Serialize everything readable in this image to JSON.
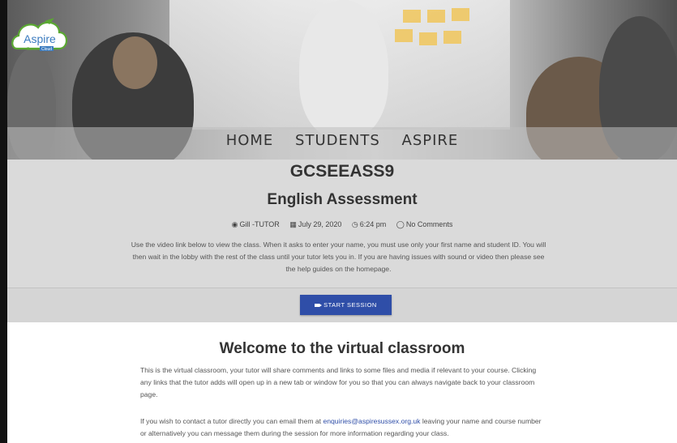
{
  "logo": {
    "name": "Aspire",
    "sub_left": "Sussex",
    "sub_right": "Cloud"
  },
  "nav": {
    "items": [
      "HOME",
      "STUDENTS",
      "ASPIRE"
    ]
  },
  "course": {
    "code": "GCSEEASS9",
    "title": "English Assessment"
  },
  "meta": {
    "author": "Gill -TUTOR",
    "date": "July 29, 2020",
    "time": "6:24 pm",
    "comments": "No Comments"
  },
  "intro": "Use the video link below to view the class. When it asks to enter your name, you must use only your first name and student ID. You will then wait in the lobby with the rest of the class until your tutor lets you in. If you are having issues with sound or video then please see the help guides on the homepage.",
  "start_button": {
    "label": "START SESSION"
  },
  "welcome": {
    "heading": "Welcome to the virtual classroom",
    "para1": "This is the virtual classroom, your tutor will share comments and links to some files and media if relevant to your course. Clicking any links that the tutor adds will open up in a new tab or window for you so that you can always navigate back to your classroom page.",
    "para2_before": "If you wish to contact a tutor directly you can email them at ",
    "para2_email": "enquiries@aspiresussex.org.uk",
    "para2_after": " leaving your name and course number or alternatively you can message them during the session for more information regarding your class."
  },
  "colors": {
    "accent": "#2f4ea8",
    "logo_green": "#5aa832",
    "logo_blue": "#3b7bbf"
  }
}
